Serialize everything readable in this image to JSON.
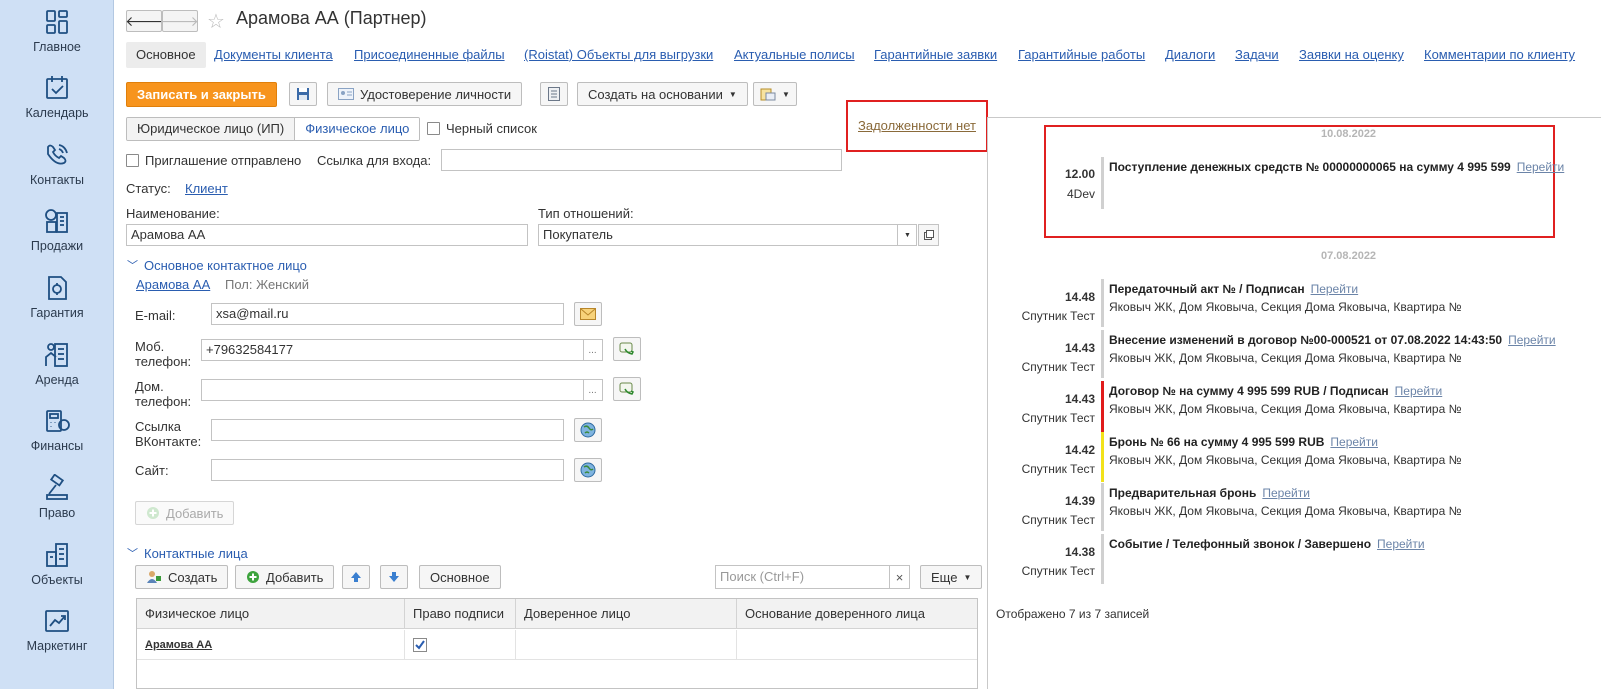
{
  "sidebar": {
    "items": [
      {
        "label": "Главное",
        "icon": "dashboard-icon"
      },
      {
        "label": "Календарь",
        "icon": "calendar-check-icon"
      },
      {
        "label": "Контакты",
        "icon": "contacts-phone-icon"
      },
      {
        "label": "Продажи",
        "icon": "sales-building-icon"
      },
      {
        "label": "Гарантия",
        "icon": "warranty-document-icon"
      },
      {
        "label": "Аренда",
        "icon": "rent-building-icon"
      },
      {
        "label": "Финансы",
        "icon": "finance-calculator-icon"
      },
      {
        "label": "Право",
        "icon": "law-gavel-icon"
      },
      {
        "label": "Объекты",
        "icon": "objects-building-icon"
      },
      {
        "label": "Маркетинг",
        "icon": "marketing-chart-icon"
      }
    ]
  },
  "header": {
    "title": "Арамова АА (Партнер)",
    "back_symbol": "🡐",
    "forward_symbol": "🡒",
    "star_symbol": "☆"
  },
  "tabs": [
    "Основное",
    "Документы клиента",
    "Присоединенные файлы",
    "(Roistat) Объекты для выгрузки",
    "Актуальные полисы",
    "Гарантийные заявки",
    "Гарантийные работы",
    "Диалоги",
    "Задачи",
    "Заявки на оценку",
    "Комментарии по клиенту"
  ],
  "toolbar": {
    "save_close": "Записать и закрыть",
    "identity": "Удостоверение личности",
    "create_based": "Создать на основании"
  },
  "form": {
    "entity_types": [
      "Юридическое лицо (ИП)",
      "Физическое лицо"
    ],
    "blacklist": "Черный список",
    "invitation_sent": "Приглашение отправлено",
    "login_link_label": "Ссылка для входа:",
    "login_link_value": "",
    "debt_link": "Задолженности нет",
    "status_label": "Статус:",
    "status_value": "Клиент",
    "name_label": "Наименование:",
    "name_value": "Арамова АА",
    "relation_label": "Тип отношений:",
    "relation_value": "Покупатель",
    "main_contact_header": "Основное контактное лицо",
    "main_contact_name": "Арамова АА",
    "gender": "Пол: Женский",
    "email_label": "E-mail:",
    "email_value": "xsa@mail.ru",
    "mobile_label_1": "Моб.",
    "mobile_label_2": "телефон:",
    "mobile_value": "+79632584177",
    "home_label_1": "Дом.",
    "home_label_2": "телефон:",
    "home_value": "",
    "vk_label_1": "Ссылка",
    "vk_label_2": "ВКонтакте:",
    "vk_value": "",
    "site_label": "Сайт:",
    "site_value": "",
    "add_button": "Добавить",
    "dots": "..."
  },
  "contacts": {
    "header": "Контактные лица",
    "create": "Создать",
    "add": "Добавить",
    "main": "Основное",
    "search_placeholder": "Поиск (Ctrl+F)",
    "more": "Еще",
    "clear": "×",
    "columns": [
      "Физическое лицо",
      "Право подписи",
      "Доверенное лицо",
      "Основание доверенного лица"
    ],
    "rows": [
      {
        "person": "Арамова АА",
        "sign": true,
        "trusted": "",
        "basis": ""
      }
    ]
  },
  "timeline": {
    "groups": [
      {
        "date": "10.08.2022",
        "events": [
          {
            "time": "12.00",
            "user": "4Dev",
            "title": "Поступление денежных средств № 00000000065 на сумму 4 995 599",
            "link": "Перейти",
            "sub": "",
            "bar": "#d0d0d0"
          }
        ]
      },
      {
        "date": "07.08.2022",
        "events": [
          {
            "time": "14.48",
            "user": "Спутник Тест",
            "title": "Передаточный акт № / Подписан",
            "link": "Перейти",
            "sub": "Яковыч ЖК, Дом Яковыча, Секция Дома Яковыча, Квартира №",
            "bar": "#d0d0d0"
          },
          {
            "time": "14.43",
            "user": "Спутник Тест",
            "title": "Внесение изменений в договор №00-000521 от 07.08.2022 14:43:50",
            "link": "Перейти",
            "sub": "Яковыч ЖК, Дом Яковыча, Секция Дома Яковыча, Квартира №",
            "bar": "#d0d0d0"
          },
          {
            "time": "14.43",
            "user": "Спутник Тест",
            "title": "Договор № на сумму 4 995 599 RUB / Подписан",
            "link": "Перейти",
            "sub": "Яковыч ЖК, Дом Яковыча, Секция Дома Яковыча, Квартира №",
            "bar": "#e01b1b"
          },
          {
            "time": "14.42",
            "user": "Спутник Тест",
            "title": "Бронь № 66 на сумму 4 995 599 RUB",
            "link": "Перейти",
            "sub": "Яковыч ЖК, Дом Яковыча, Секция Дома Яковыча, Квартира №",
            "bar": "#f2e21a"
          },
          {
            "time": "14.39",
            "user": "Спутник Тест",
            "title": "Предварительная бронь",
            "link": "Перейти",
            "sub": "Яковыч ЖК, Дом Яковыча, Секция Дома Яковыча, Квартира №",
            "bar": "#d0d0d0"
          },
          {
            "time": "14.38",
            "user": "Спутник Тест",
            "title": "Событие / Телефонный звонок / Завершено",
            "link": "Перейти",
            "sub": "",
            "bar": "#d0d0d0"
          }
        ]
      }
    ],
    "footer": "Отображено 7 из 7 записей"
  }
}
